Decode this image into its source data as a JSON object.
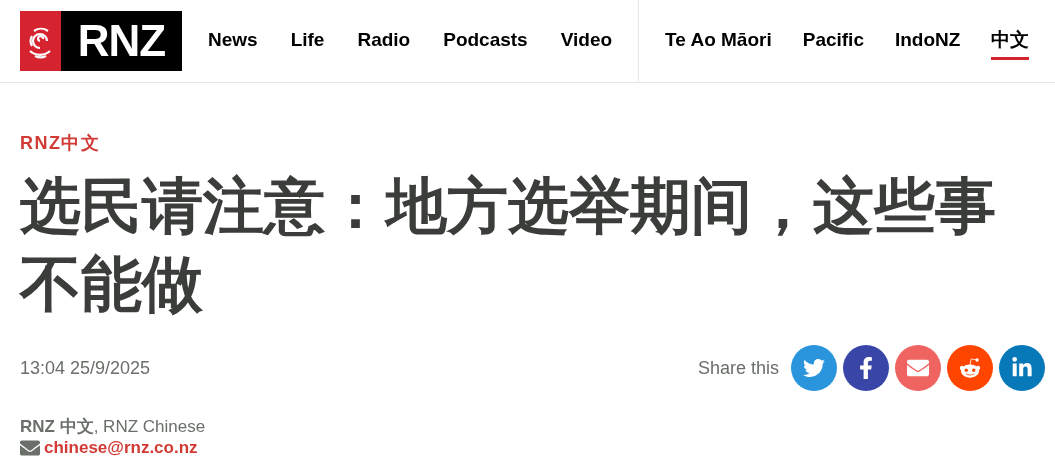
{
  "logo": {
    "text": "RNZ"
  },
  "nav": [
    {
      "label": "News",
      "selected": false
    },
    {
      "label": "Life",
      "selected": false
    },
    {
      "label": "Radio",
      "selected": false
    },
    {
      "label": "Podcasts",
      "selected": false
    },
    {
      "label": "Video",
      "selected": false
    }
  ],
  "nav_secondary": [
    {
      "label": "Te Ao Māori",
      "selected": false
    },
    {
      "label": "Pacific",
      "selected": false
    },
    {
      "label": "IndoNZ",
      "selected": false
    },
    {
      "label": "中文",
      "selected": true
    }
  ],
  "article": {
    "kicker": "RNZ中文",
    "title": "选民请注意：地方选举期间，这些事不能做",
    "date": "13:04 25/9/2025",
    "byline": "**RNZ 中文**, RNZ Chinese",
    "email": "chinese@rnz.co.nz"
  },
  "share": {
    "label": "Share this",
    "buttons": [
      {
        "kind": "twitter",
        "color": "#2a95dc"
      },
      {
        "kind": "facebook",
        "color": "#3a45a8"
      },
      {
        "kind": "email",
        "color": "#ef6460"
      },
      {
        "kind": "reddit",
        "color": "#ff4500"
      },
      {
        "kind": "linkedin",
        "color": "#0879b8"
      }
    ]
  }
}
